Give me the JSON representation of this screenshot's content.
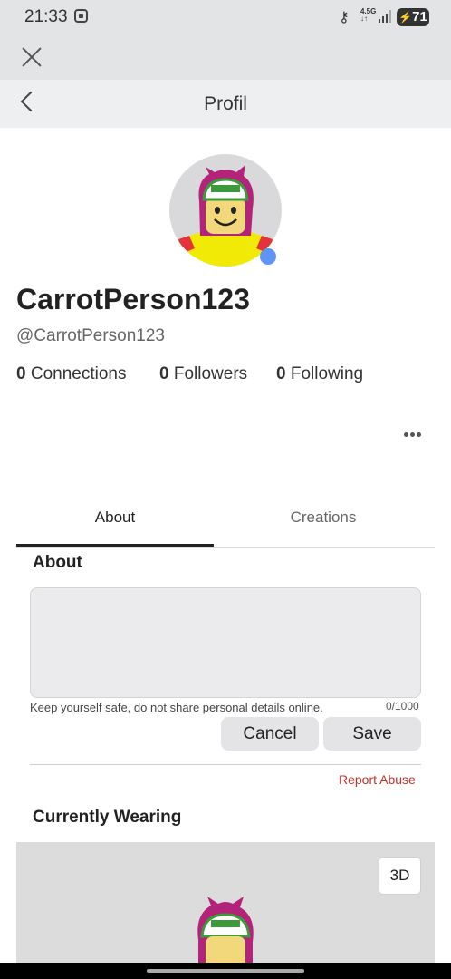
{
  "status_bar": {
    "time": "21:33",
    "network": "4.5G",
    "battery": "71",
    "icons": [
      "screenshot-icon",
      "vpn-key-icon",
      "signal-icon",
      "battery-icon"
    ]
  },
  "header": {
    "title": "Profil",
    "close_icon": "close-icon",
    "back_icon": "chevron-left-icon"
  },
  "profile": {
    "display_name": "CarrotPerson123",
    "username": "@CarrotPerson123",
    "online": true,
    "online_color": "#5f94f3",
    "stats": [
      {
        "count": "0",
        "label": "Connections"
      },
      {
        "count": "0",
        "label": "Followers"
      },
      {
        "count": "0",
        "label": "Following"
      }
    ]
  },
  "tabs": [
    {
      "label": "About",
      "active": true
    },
    {
      "label": "Creations",
      "active": false
    }
  ],
  "about": {
    "heading": "About",
    "text_value": "",
    "safety_note": "Keep yourself safe, do not share personal details online.",
    "char_count": "0/1000",
    "cancel_label": "Cancel",
    "save_label": "Save",
    "report_label": "Report Abuse",
    "report_color": "#c8302a"
  },
  "wearing": {
    "heading": "Currently Wearing",
    "view_3d_label": "3D"
  }
}
